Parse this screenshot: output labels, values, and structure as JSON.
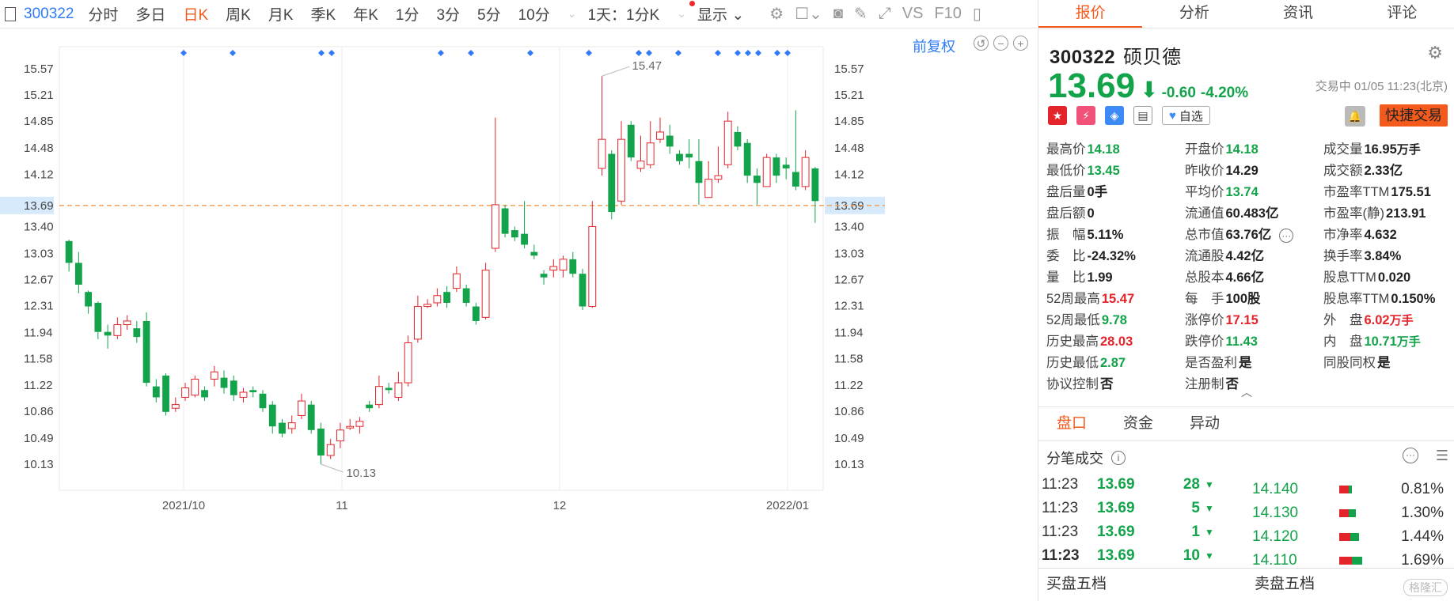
{
  "toolbar": {
    "code": "300322",
    "items": [
      "分时",
      "多日",
      "日K",
      "周K",
      "月K",
      "季K",
      "年K",
      "1分",
      "3分",
      "5分",
      "10分",
      "1天：1分K"
    ],
    "active_index": 2,
    "display_label": "显示",
    "vs_label": "VS",
    "f10_label": "F10"
  },
  "chart_controls": {
    "adjust_label": "前复权"
  },
  "chart_data": {
    "type": "candlestick",
    "y_ticks": [
      "15.57",
      "15.21",
      "14.85",
      "14.48",
      "14.12",
      "13.69",
      "13.40",
      "13.03",
      "12.67",
      "12.31",
      "11.94",
      "11.58",
      "11.22",
      "10.86",
      "10.49",
      "10.13"
    ],
    "y_tick_values": [
      15.57,
      15.21,
      14.85,
      14.48,
      14.12,
      13.69,
      13.4,
      13.03,
      12.67,
      12.31,
      11.94,
      11.58,
      11.22,
      10.86,
      10.49,
      10.13
    ],
    "x_labels": [
      "2021/10",
      "11",
      "12",
      "2022/01"
    ],
    "current_price": 13.69,
    "max_label": "15.47",
    "min_label": "10.13",
    "candles": [
      [
        13.2,
        12.9,
        13.22,
        12.78
      ],
      [
        12.9,
        12.6,
        13.05,
        12.48
      ],
      [
        12.5,
        12.3,
        12.52,
        12.2
      ],
      [
        12.35,
        11.95,
        12.37,
        11.85
      ],
      [
        11.95,
        11.9,
        12.05,
        11.72
      ],
      [
        11.9,
        12.05,
        12.15,
        11.85
      ],
      [
        12.05,
        12.1,
        12.18,
        11.98
      ],
      [
        12.0,
        11.88,
        12.1,
        11.8
      ],
      [
        12.1,
        11.25,
        12.22,
        11.2
      ],
      [
        11.2,
        11.05,
        11.3,
        10.98
      ],
      [
        11.35,
        10.85,
        11.38,
        10.8
      ],
      [
        10.9,
        10.95,
        11.05,
        10.85
      ],
      [
        11.05,
        11.18,
        11.25,
        11.0
      ],
      [
        11.08,
        11.3,
        11.35,
        11.05
      ],
      [
        11.15,
        11.05,
        11.2,
        11.0
      ],
      [
        11.3,
        11.4,
        11.48,
        11.2
      ],
      [
        11.32,
        11.18,
        11.42,
        11.1
      ],
      [
        11.28,
        11.08,
        11.35,
        11.0
      ],
      [
        11.05,
        11.12,
        11.18,
        10.98
      ],
      [
        11.15,
        11.12,
        11.2,
        11.05
      ],
      [
        11.1,
        10.9,
        11.15,
        10.85
      ],
      [
        10.95,
        10.65,
        11.0,
        10.55
      ],
      [
        10.7,
        10.55,
        10.75,
        10.5
      ],
      [
        10.62,
        10.7,
        10.8,
        10.55
      ],
      [
        10.8,
        11.0,
        11.1,
        10.75
      ],
      [
        10.95,
        10.6,
        11.0,
        10.55
      ],
      [
        10.62,
        10.25,
        10.7,
        10.13
      ],
      [
        10.25,
        10.4,
        10.48,
        10.2
      ],
      [
        10.45,
        10.6,
        10.7,
        10.35
      ],
      [
        10.65,
        10.65,
        10.75,
        10.6
      ],
      [
        10.65,
        10.72,
        10.78,
        10.55
      ],
      [
        10.95,
        10.9,
        11.0,
        10.85
      ],
      [
        10.95,
        11.2,
        11.35,
        10.9
      ],
      [
        11.18,
        11.15,
        11.25,
        11.1
      ],
      [
        11.05,
        11.25,
        11.4,
        11.0
      ],
      [
        11.25,
        11.8,
        11.9,
        11.2
      ],
      [
        11.85,
        12.3,
        12.45,
        11.8
      ],
      [
        12.3,
        12.33,
        12.4,
        12.28
      ],
      [
        12.35,
        12.45,
        12.55,
        12.3
      ],
      [
        12.5,
        12.35,
        12.58,
        12.28
      ],
      [
        12.55,
        12.75,
        12.85,
        12.5
      ],
      [
        12.55,
        12.35,
        12.6,
        12.3
      ],
      [
        12.3,
        12.1,
        12.35,
        12.05
      ],
      [
        12.15,
        12.8,
        12.9,
        12.12
      ],
      [
        13.1,
        13.7,
        14.9,
        13.05
      ],
      [
        13.65,
        13.3,
        13.7,
        13.25
      ],
      [
        13.35,
        13.25,
        13.4,
        13.2
      ],
      [
        13.3,
        13.15,
        13.75,
        13.1
      ],
      [
        13.05,
        13.0,
        13.15,
        12.95
      ],
      [
        12.75,
        12.7,
        12.8,
        12.6
      ],
      [
        12.8,
        12.85,
        12.95,
        12.7
      ],
      [
        12.8,
        12.95,
        13.0,
        12.7
      ],
      [
        12.95,
        12.75,
        13.05,
        12.7
      ],
      [
        12.75,
        12.3,
        12.82,
        12.25
      ],
      [
        12.3,
        13.4,
        13.75,
        12.28
      ],
      [
        14.2,
        14.6,
        15.47,
        14.1
      ],
      [
        14.4,
        13.6,
        14.45,
        13.5
      ],
      [
        13.75,
        14.6,
        14.85,
        13.7
      ],
      [
        14.8,
        14.35,
        14.85,
        14.3
      ],
      [
        14.2,
        14.3,
        14.65,
        14.15
      ],
      [
        14.25,
        14.55,
        14.85,
        14.2
      ],
      [
        14.6,
        14.7,
        14.9,
        14.55
      ],
      [
        14.65,
        14.5,
        14.8,
        14.4
      ],
      [
        14.4,
        14.3,
        14.45,
        14.25
      ],
      [
        14.4,
        14.35,
        14.6,
        14.2
      ],
      [
        14.3,
        14.0,
        14.6,
        13.7
      ],
      [
        13.8,
        14.05,
        14.3,
        13.8
      ],
      [
        14.05,
        14.1,
        14.5,
        14.0
      ],
      [
        14.25,
        14.85,
        14.98,
        14.2
      ],
      [
        14.7,
        14.5,
        14.78,
        14.45
      ],
      [
        14.55,
        14.1,
        14.6,
        14.0
      ],
      [
        14.1,
        14.0,
        14.2,
        13.7
      ],
      [
        13.95,
        14.35,
        14.4,
        13.95
      ],
      [
        14.35,
        14.1,
        14.4,
        14.0
      ],
      [
        14.25,
        14.2,
        14.35,
        14.05
      ],
      [
        14.15,
        13.95,
        15.0,
        13.9
      ],
      [
        13.95,
        14.35,
        14.45,
        13.9
      ],
      [
        14.2,
        13.75,
        14.22,
        13.45
      ]
    ]
  },
  "panel": {
    "tabs": [
      "报价",
      "分析",
      "资讯",
      "评论"
    ],
    "active_tab": 0,
    "code": "300322",
    "name": "硕贝德",
    "price": "13.69",
    "change": "-0.60",
    "change_pct": "-4.20%",
    "trade_status": "交易中 01/05 11:23(北京)",
    "watch_label": "自选",
    "fast_trade_label": "快捷交易",
    "quotes": [
      {
        "l": "最高价",
        "v": "14.18",
        "c": "down"
      },
      {
        "l": "开盘价",
        "v": "14.18",
        "c": "down"
      },
      {
        "l": "成交量",
        "v": "16.95",
        "u": "万手",
        "c": "dark"
      },
      {
        "l": "最低价",
        "v": "13.45",
        "c": "down"
      },
      {
        "l": "昨收价",
        "v": "14.29",
        "c": "dark"
      },
      {
        "l": "成交额",
        "v": "2.33亿",
        "c": "dark"
      },
      {
        "l": "盘后量",
        "v": "0手",
        "c": "dark"
      },
      {
        "l": "平均价",
        "v": "13.74",
        "c": "down"
      },
      {
        "l": "市盈率TTM",
        "v": "175.51",
        "c": "dark"
      },
      {
        "l": "盘后额",
        "v": "0",
        "c": "dark"
      },
      {
        "l": "流通值",
        "v": "60.483亿",
        "c": "dark"
      },
      {
        "l": "市盈率(静)",
        "v": "213.91",
        "c": "dark"
      },
      {
        "l": "振　幅",
        "v": "5.11%",
        "c": "dark"
      },
      {
        "l": "总市值",
        "v": "63.76亿",
        "c": "dark"
      },
      {
        "l": "市净率",
        "v": "4.632",
        "c": "dark"
      },
      {
        "l": "委　比",
        "v": "-24.32%",
        "c": "dark"
      },
      {
        "l": "流通股",
        "v": "4.42亿",
        "c": "dark"
      },
      {
        "l": "换手率",
        "v": "3.84%",
        "c": "dark"
      },
      {
        "l": "量　比",
        "v": "1.99",
        "c": "dark"
      },
      {
        "l": "总股本",
        "v": "4.66亿",
        "c": "dark"
      },
      {
        "l": "股息TTM",
        "v": "0.020",
        "c": "dark"
      },
      {
        "l": "52周最高",
        "v": "15.47",
        "c": "up"
      },
      {
        "l": "每　手",
        "v": "100股",
        "c": "dark"
      },
      {
        "l": "股息率TTM",
        "v": "0.150%",
        "c": "dark"
      },
      {
        "l": "52周最低",
        "v": "9.78",
        "c": "down"
      },
      {
        "l": "涨停价",
        "v": "17.15",
        "c": "up"
      },
      {
        "l": "外　盘",
        "v": "6.02",
        "u": "万手",
        "c": "up"
      },
      {
        "l": "历史最高",
        "v": "28.03",
        "c": "up"
      },
      {
        "l": "跌停价",
        "v": "11.43",
        "c": "down"
      },
      {
        "l": "内　盘",
        "v": "10.71",
        "u": "万手",
        "c": "down"
      },
      {
        "l": "历史最低",
        "v": "2.87",
        "c": "down"
      },
      {
        "l": "是否盈利",
        "v": "是",
        "c": "dark"
      },
      {
        "l": "同股同权",
        "v": "是",
        "c": "dark"
      },
      {
        "l": "协议控制",
        "v": "否",
        "c": "dark"
      },
      {
        "l": "注册制",
        "v": "否",
        "c": "dark"
      }
    ],
    "sub_tabs": [
      "盘口",
      "资金",
      "异动"
    ],
    "ticks_title": "分笔成交",
    "ticks": [
      {
        "t": "11:23",
        "p": "13.69",
        "n": "28",
        "bold": false
      },
      {
        "t": "11:23",
        "p": "13.69",
        "n": "5",
        "bold": false
      },
      {
        "t": "11:23",
        "p": "13.69",
        "n": "1",
        "bold": false
      },
      {
        "t": "11:23",
        "p": "13.69",
        "n": "10",
        "bold": true
      }
    ],
    "depth": [
      {
        "p": "14.140",
        "pct": "0.81%",
        "r": 0.3,
        "g": 0.2
      },
      {
        "p": "14.130",
        "pct": "1.30%",
        "r": 0.3,
        "g": 0.45
      },
      {
        "p": "14.120",
        "pct": "1.44%",
        "r": 0.35,
        "g": 0.55
      },
      {
        "p": "14.110",
        "pct": "1.69%",
        "r": 0.4,
        "g": 0.65
      }
    ],
    "bottom_tabs": [
      "买盘五档",
      "卖盘五档"
    ],
    "watermark": "格隆汇"
  },
  "colors": {
    "up": "#e3242b",
    "down": "#13a34a",
    "accent": "#f35a1c",
    "link": "#2f7cf6",
    "price_line": "#f59a4b"
  }
}
